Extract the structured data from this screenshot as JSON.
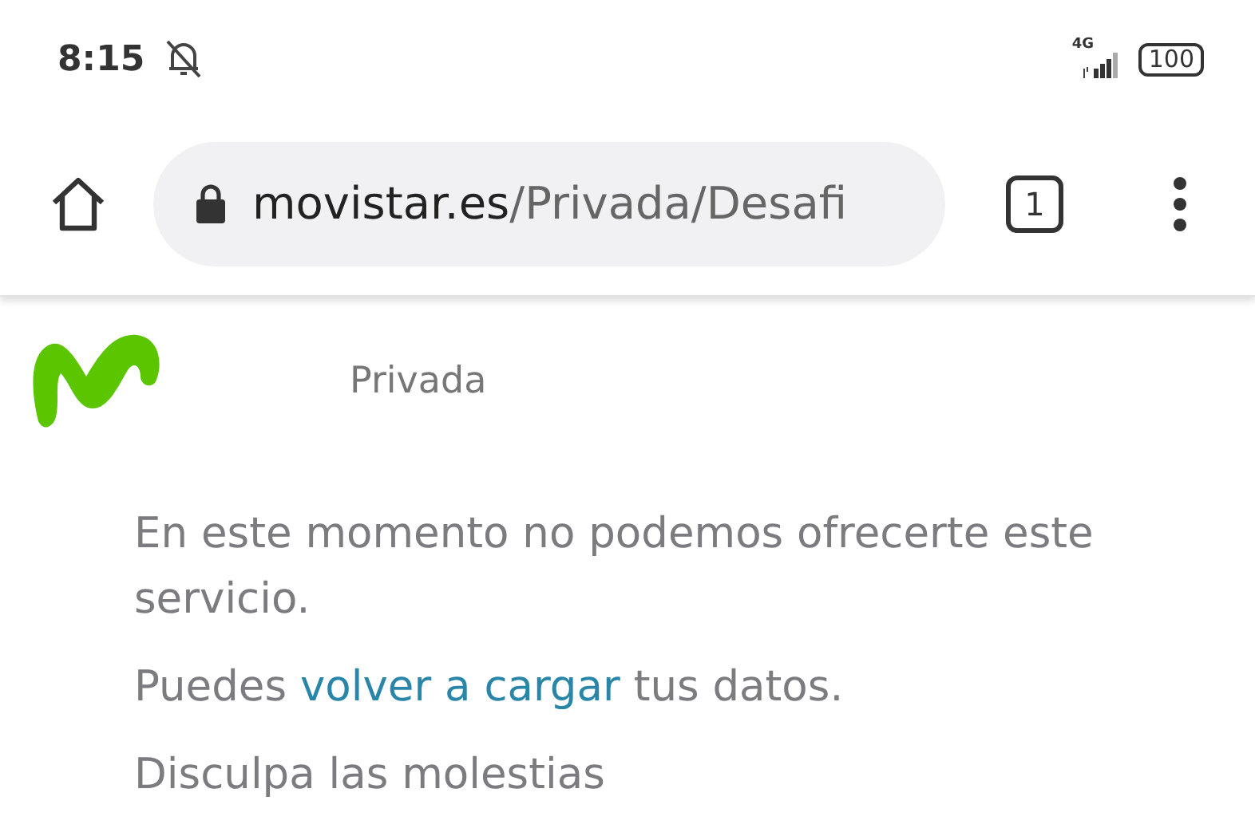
{
  "status_bar": {
    "time": "8:15",
    "notifications_muted": true,
    "network": "4G",
    "battery": "100"
  },
  "browser_bar": {
    "url_domain": "movistar.es",
    "url_path": "/Privada/Desafi",
    "secure": true,
    "tab_count": "1"
  },
  "header": {
    "section": "Privada"
  },
  "message": {
    "paragraphs": [
      {
        "kind": "text",
        "text": "En este momento no podemos ofrecerte este servicio."
      },
      {
        "kind": "link",
        "before": "Puedes ",
        "link": "volver a cargar",
        "after": " tus datos."
      },
      {
        "kind": "text",
        "text": "Disculpa las molestias"
      }
    ]
  }
}
